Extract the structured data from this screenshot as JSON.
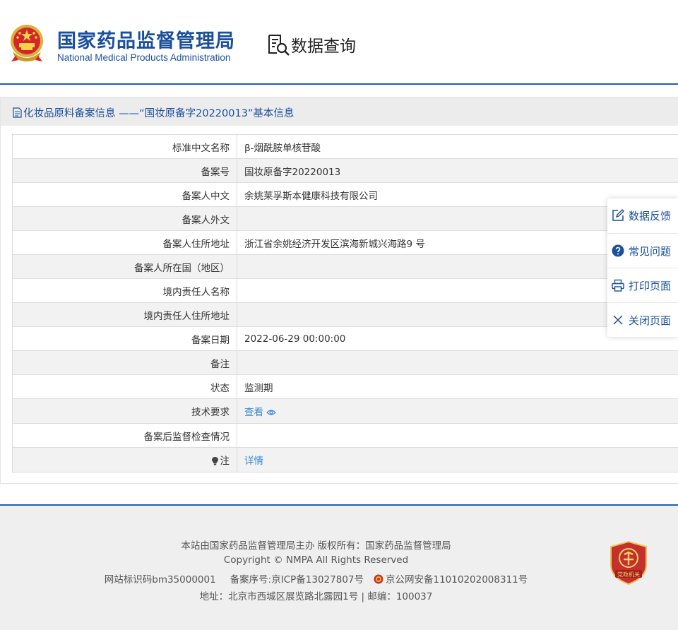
{
  "header": {
    "brand_cn": "国家药品监督管理局",
    "brand_en": "National Medical Products Administration",
    "query_title": "数据查询",
    "brand_color": "#1a4f9c"
  },
  "panel": {
    "title": "化妆品原料备案信息 ——“国妆原备字20220013”基本信息"
  },
  "rows": [
    {
      "label": "标准中文名称",
      "value": "β-烟酰胺单核苷酸"
    },
    {
      "label": "备案号",
      "value": "国妆原备字20220013"
    },
    {
      "label": "备案人中文",
      "value": "余姚莱孚斯本健康科技有限公司"
    },
    {
      "label": "备案人外文",
      "value": ""
    },
    {
      "label": "备案人住所地址",
      "value": "浙江省余姚经济开发区滨海新城兴海路9 号"
    },
    {
      "label": "备案人所在国（地区）",
      "value": ""
    },
    {
      "label": "境内责任人名称",
      "value": ""
    },
    {
      "label": "境内责任人住所地址",
      "value": ""
    },
    {
      "label": "备案日期",
      "value": "2022-06-29 00:00:00"
    },
    {
      "label": "备注",
      "value": ""
    },
    {
      "label": "状态",
      "value": "监测期"
    },
    {
      "label": "技术要求",
      "link": "查看"
    },
    {
      "label": "备案后监督检查情况",
      "value": ""
    },
    {
      "label": "注",
      "link": "详情"
    }
  ],
  "side_menu": {
    "feedback": "数据反馈",
    "faq": "常见问题",
    "print": "打印页面",
    "close": "关闭页面"
  },
  "footer": {
    "line1": "本站由国家药品监督管理局主办 版权所有：国家药品监督管理局",
    "line2": "Copyright © NMPA All Rights Reserved",
    "site_code": "网站标识码bm35000001",
    "icp": "备案序号:京ICP备13027807号",
    "police": "京公网安备11010202008311号",
    "address": "地址：北京市西城区展览路北露园1号 | 邮编：100037",
    "badge_text": "党政机关"
  },
  "icons": [
    "emblem-icon",
    "query-icon",
    "document-icon",
    "eye-icon",
    "bulb-icon",
    "edit-icon",
    "question-icon",
    "printer-icon",
    "close-icon",
    "police-icon",
    "party-badge-icon"
  ]
}
